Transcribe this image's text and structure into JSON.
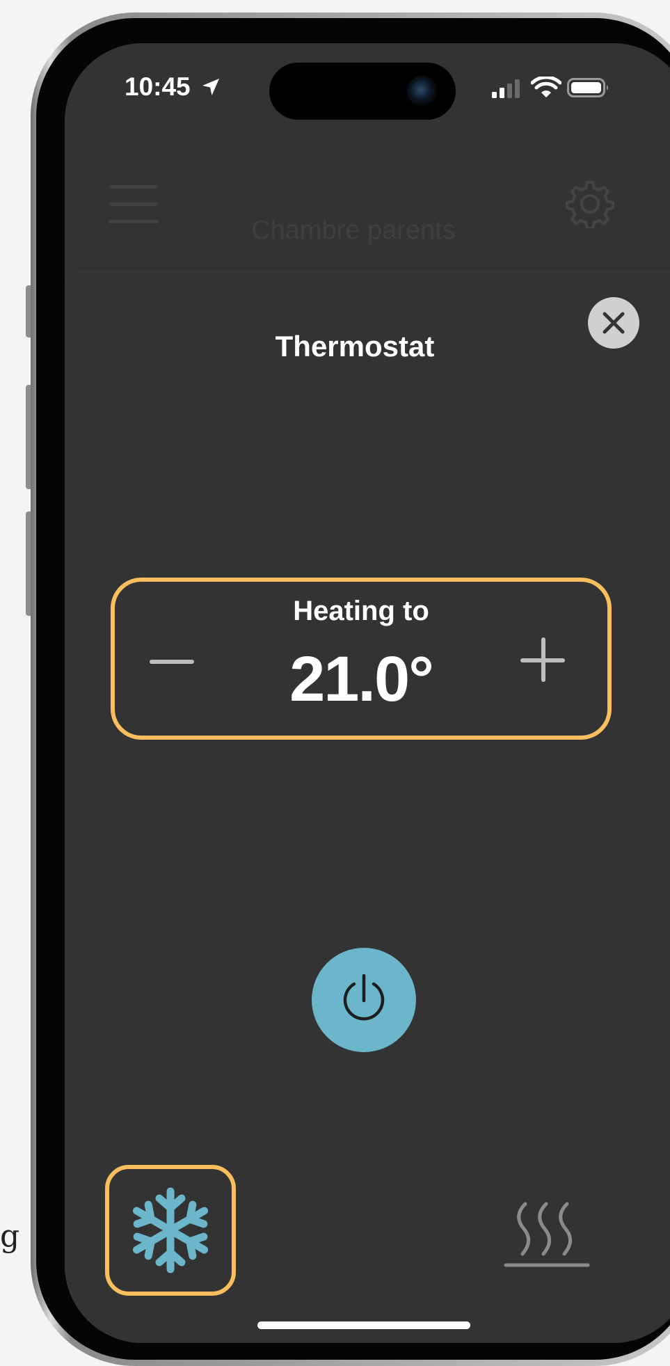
{
  "stray_text": "g",
  "status_bar": {
    "time": "10:45",
    "location_icon": "location-arrow-icon",
    "signal_icon": "cellular-signal-icon",
    "wifi_icon": "wifi-icon",
    "battery_icon": "battery-icon"
  },
  "app_bar": {
    "title": "Chambre parents",
    "menu_icon": "hamburger-menu-icon",
    "settings_icon": "gear-icon"
  },
  "sheet": {
    "title": "Thermostat",
    "close_icon": "close-icon"
  },
  "thermostat": {
    "mode_label": "Heating to",
    "target_temperature": "21.0°",
    "decrease_icon": "minus-icon",
    "increase_icon": "plus-icon"
  },
  "controls": {
    "power_icon": "power-icon",
    "cool_icon": "snowflake-icon",
    "heat_icon": "heat-waves-icon"
  },
  "colors": {
    "screen_bg": "#333333",
    "accent_outline": "#f9be5d",
    "power_bg": "#6cb6cc",
    "snowflake": "#6cb6cc"
  }
}
